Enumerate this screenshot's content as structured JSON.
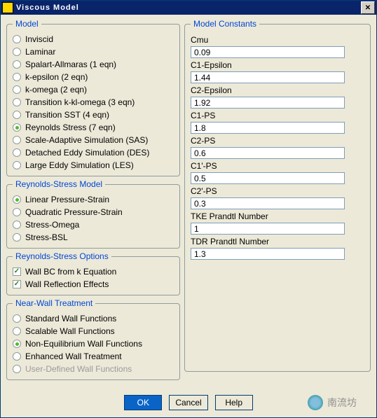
{
  "window": {
    "title": "Viscous Model"
  },
  "model": {
    "legend": "Model",
    "items": [
      {
        "label": "Inviscid",
        "sel": false
      },
      {
        "label": "Laminar",
        "sel": false
      },
      {
        "label": "Spalart-Allmaras (1 eqn)",
        "sel": false
      },
      {
        "label": "k-epsilon (2 eqn)",
        "sel": false
      },
      {
        "label": "k-omega (2 eqn)",
        "sel": false
      },
      {
        "label": "Transition k-kl-omega (3 eqn)",
        "sel": false
      },
      {
        "label": "Transition SST (4 eqn)",
        "sel": false
      },
      {
        "label": "Reynolds Stress (7 eqn)",
        "sel": true
      },
      {
        "label": "Scale-Adaptive Simulation (SAS)",
        "sel": false
      },
      {
        "label": "Detached Eddy Simulation (DES)",
        "sel": false
      },
      {
        "label": "Large Eddy Simulation (LES)",
        "sel": false
      }
    ]
  },
  "rsm": {
    "legend": "Reynolds-Stress Model",
    "items": [
      {
        "label": "Linear Pressure-Strain",
        "sel": true
      },
      {
        "label": "Quadratic Pressure-Strain",
        "sel": false
      },
      {
        "label": "Stress-Omega",
        "sel": false
      },
      {
        "label": "Stress-BSL",
        "sel": false
      }
    ]
  },
  "rso": {
    "legend": "Reynolds-Stress Options",
    "items": [
      {
        "label": "Wall BC from k Equation",
        "sel": true
      },
      {
        "label": "Wall Reflection Effects",
        "sel": true
      }
    ]
  },
  "nwt": {
    "legend": "Near-Wall Treatment",
    "items": [
      {
        "label": "Standard Wall Functions",
        "sel": false,
        "dis": false
      },
      {
        "label": "Scalable Wall Functions",
        "sel": false,
        "dis": false
      },
      {
        "label": "Non-Equilibrium Wall Functions",
        "sel": true,
        "dis": false
      },
      {
        "label": "Enhanced Wall Treatment",
        "sel": false,
        "dis": false
      },
      {
        "label": "User-Defined Wall Functions",
        "sel": false,
        "dis": true
      }
    ]
  },
  "constants": {
    "legend": "Model Constants",
    "fields": [
      {
        "label": "Cmu",
        "value": "0.09"
      },
      {
        "label": "C1-Epsilon",
        "value": "1.44"
      },
      {
        "label": "C2-Epsilon",
        "value": "1.92"
      },
      {
        "label": "C1-PS",
        "value": "1.8"
      },
      {
        "label": "C2-PS",
        "value": "0.6"
      },
      {
        "label": "C1'-PS",
        "value": "0.5"
      },
      {
        "label": "C2'-PS",
        "value": "0.3"
      },
      {
        "label": "TKE Prandtl Number",
        "value": "1"
      },
      {
        "label": "TDR Prandtl Number",
        "value": "1.3"
      }
    ]
  },
  "buttons": {
    "ok": "OK",
    "cancel": "Cancel",
    "help": "Help"
  },
  "watermark": "南流坊"
}
